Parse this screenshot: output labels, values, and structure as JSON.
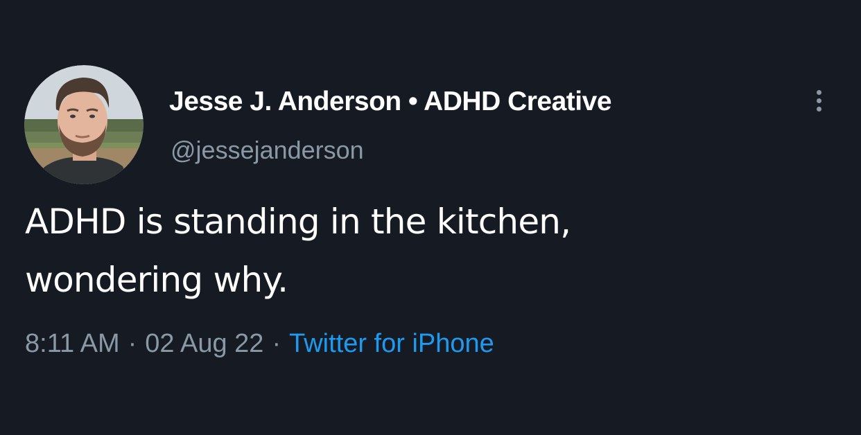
{
  "author": {
    "display_name": "Jesse J. Anderson • ADHD Creative",
    "handle": "@jessejanderson",
    "avatar_icon": "profile-photo"
  },
  "tweet": {
    "text_lines": [
      "ADHD is standing in the kitchen,",
      "wondering why."
    ],
    "time": "8:11 AM",
    "date": "02 Aug 22",
    "separator": "·",
    "source": "Twitter for iPhone"
  },
  "actions": {
    "more_icon": "more-vertical-icon"
  },
  "colors": {
    "background": "#151a23",
    "text_primary": "#ffffff",
    "text_secondary": "#8b98a5",
    "link": "#1d9bf0"
  }
}
